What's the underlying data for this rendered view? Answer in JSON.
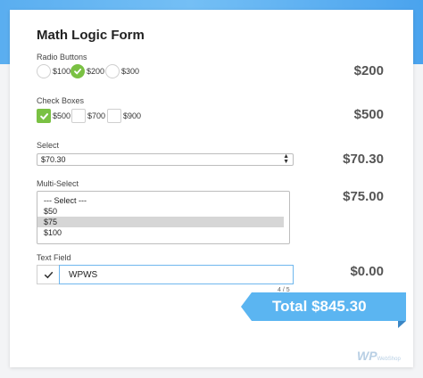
{
  "form": {
    "title": "Math Logic Form",
    "radio": {
      "label": "Radio Buttons",
      "options": [
        {
          "label": "$100",
          "selected": false
        },
        {
          "label": "$200",
          "selected": true
        },
        {
          "label": "$300",
          "selected": false
        }
      ],
      "price": "$200"
    },
    "checkbox": {
      "label": "Check Boxes",
      "options": [
        {
          "label": "$500",
          "checked": true
        },
        {
          "label": "$700",
          "checked": false
        },
        {
          "label": "$900",
          "checked": false
        }
      ],
      "price": "$500"
    },
    "select": {
      "label": "Select",
      "value": "$70.30",
      "price": "$70.30"
    },
    "multiselect": {
      "label": "Multi-Select",
      "options": [
        {
          "label": "--- Select ---",
          "selected": false
        },
        {
          "label": "$50",
          "selected": false
        },
        {
          "label": "$75",
          "selected": true
        },
        {
          "label": "$100",
          "selected": false
        }
      ],
      "price": "$75.00"
    },
    "textfield": {
      "label": "Text Field",
      "value": "WPWS",
      "counter": "4 / 5",
      "price": "$0.00"
    },
    "total": "Total $845.30"
  },
  "watermark": {
    "main": "WP",
    "sub": "WebShop"
  },
  "colors": {
    "accent_green": "#7ac143",
    "total_blue": "#5bb5f1",
    "header_blue": "#5aaef0"
  },
  "icons": {
    "check": "check-icon",
    "select_arrows": "select-arrows-icon"
  }
}
